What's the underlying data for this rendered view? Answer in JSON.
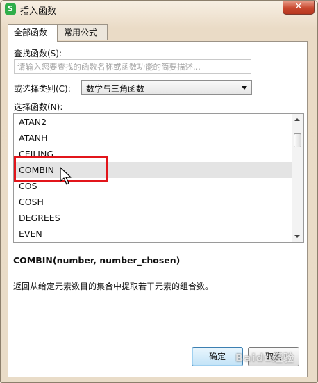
{
  "window": {
    "title": "插入函数",
    "close_label": "✕",
    "app_icon_letter": "S",
    "app_icon_color": "#2fae4a"
  },
  "tabs": [
    {
      "label": "全部函数",
      "active": true
    },
    {
      "label": "常用公式",
      "active": false
    }
  ],
  "search": {
    "label": "查找函数(S):",
    "placeholder": "请输入您要查找的函数名称或函数功能的简要描述...",
    "value": ""
  },
  "category": {
    "label": "或选择类别(C):",
    "selected": "数学与三角函数"
  },
  "function_list": {
    "label": "选择函数(N):",
    "items": [
      "ATAN2",
      "ATANH",
      "CEILING",
      "COMBIN",
      "COS",
      "COSH",
      "DEGREES",
      "EVEN"
    ],
    "selected": "COMBIN"
  },
  "details": {
    "syntax": "COMBIN(number, number_chosen)",
    "description": "返回从给定元素数目的集合中提取若干元素的组合数。"
  },
  "buttons": {
    "ok": "确定",
    "cancel": "取消"
  },
  "annotation": {
    "highlight_color": "#e2151b"
  },
  "watermark": "Baidu经验"
}
